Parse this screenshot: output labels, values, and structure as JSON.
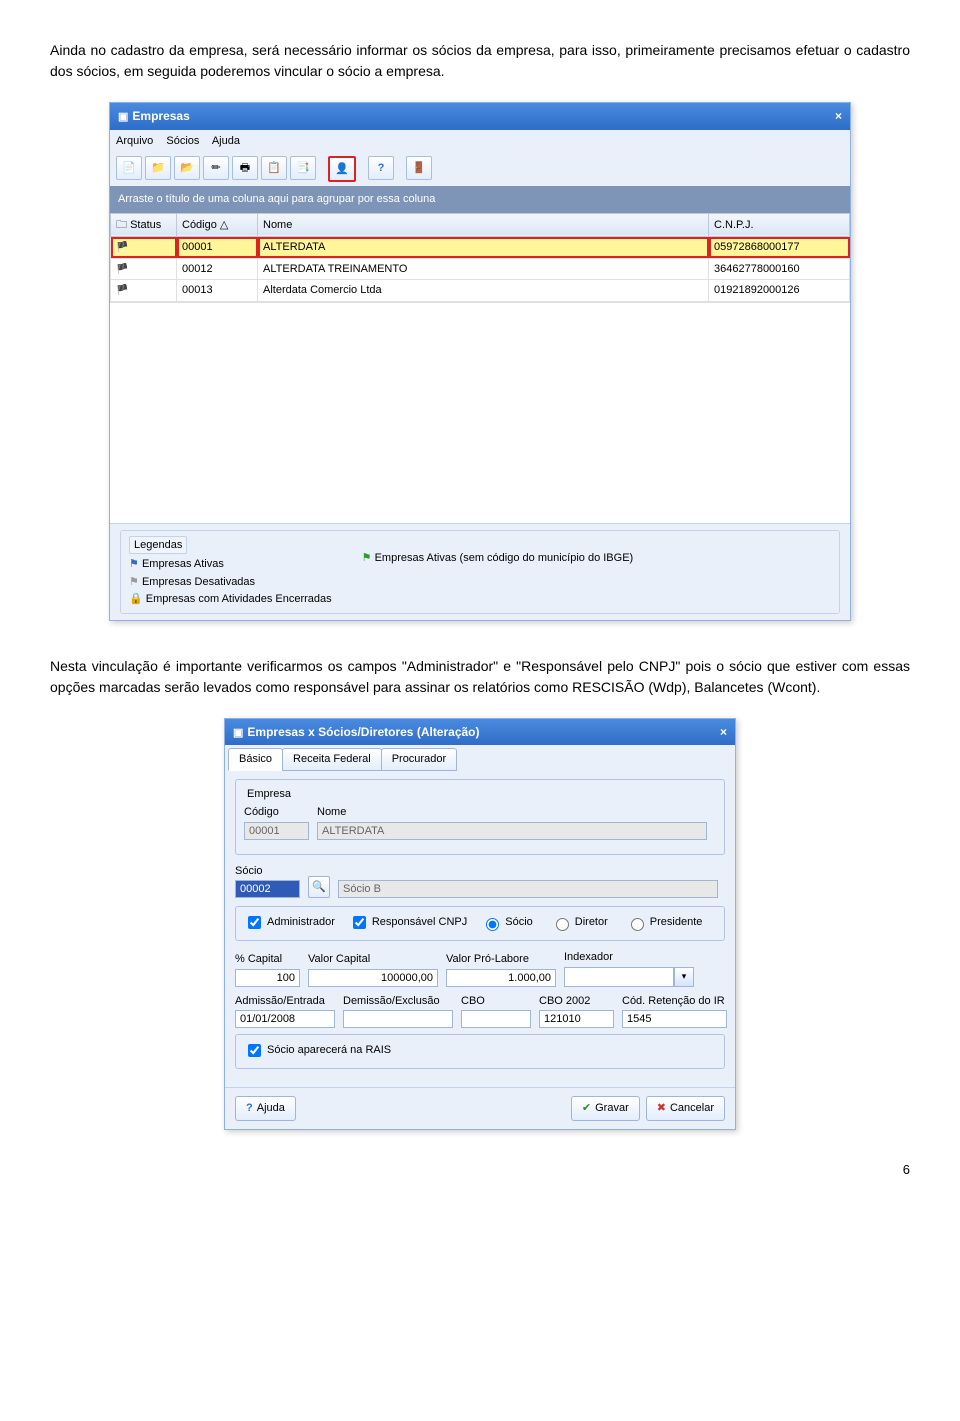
{
  "page_number": "6",
  "paragraph1": "Ainda no cadastro da empresa, será necessário informar os sócios da empresa, para isso, primeiramente precisamos efetuar o cadastro dos sócios, em seguida poderemos vincular o sócio a empresa.",
  "paragraph2": "Nesta vinculação é importante verificarmos os campos \"Administrador\" e \"Responsável pelo CNPJ\" pois o sócio que estiver com essas opções marcadas serão levados como responsável para assinar os relatórios como RESCISÃO (Wdp), Balancetes (Wcont).",
  "window1": {
    "title": "Empresas",
    "menus": [
      "Arquivo",
      "Sócios",
      "Ajuda"
    ],
    "group_hint": "Arraste o título de uma coluna aqui para agrupar por essa coluna",
    "columns": {
      "status": "Status",
      "codigo": "Código",
      "nome": "Nome",
      "cnpj": "C.N.P.J."
    },
    "rows": [
      {
        "codigo": "00001",
        "nome": "ALTERDATA",
        "cnpj": "05972868000177",
        "selected": true
      },
      {
        "codigo": "00012",
        "nome": "ALTERDATA TREINAMENTO",
        "cnpj": "36462778000160",
        "selected": false
      },
      {
        "codigo": "00013",
        "nome": "Alterdata Comercio Ltda",
        "cnpj": "01921892000126",
        "selected": false
      }
    ],
    "legend_title": "Legendas",
    "legend_ativas": "Empresas Ativas",
    "legend_desativadas": "Empresas Desativadas",
    "legend_encerradas": "Empresas com Atividades Encerradas",
    "legend_ibge": "Empresas Ativas (sem código do município do IBGE)"
  },
  "window2": {
    "title": "Empresas x Sócios/Diretores (Alteração)",
    "tabs": [
      "Básico",
      "Receita Federal",
      "Procurador"
    ],
    "empresa_box": "Empresa",
    "codigo_label": "Código",
    "nome_label": "Nome",
    "codigo_value": "00001",
    "nome_value": "ALTERDATA",
    "socio_label": "Sócio",
    "socio_value": "00002",
    "socio_nome": "Sócio B",
    "chk_admin": "Administrador",
    "chk_resp": "Responsável CNPJ",
    "rad_socio": "Sócio",
    "rad_diretor": "Diretor",
    "rad_presidente": "Presidente",
    "pct_capital_label": "% Capital",
    "pct_capital_value": "100",
    "valor_capital_label": "Valor Capital",
    "valor_capital_value": "100000,00",
    "valor_prolabore_label": "Valor Pró-Labore",
    "valor_prolabore_value": "1.000,00",
    "indexador_label": "Indexador",
    "admissao_label": "Admissão/Entrada",
    "admissao_value": "01/01/2008",
    "demissao_label": "Demissão/Exclusão",
    "demissao_value": "",
    "cbo_label": "CBO",
    "cbo_value": "",
    "cbo2002_label": "CBO 2002",
    "cbo2002_value": "121010",
    "cod_ret_label": "Cód. Retenção do IR",
    "cod_ret_value": "1545",
    "chk_rais": "Sócio aparecerá na RAIS",
    "btn_ajuda": "Ajuda",
    "btn_gravar": "Gravar",
    "btn_cancelar": "Cancelar"
  }
}
